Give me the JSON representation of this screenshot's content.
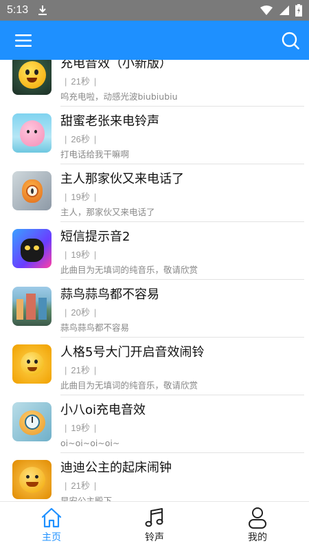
{
  "status_bar": {
    "time": "5:13"
  },
  "appbar": {
    "menu_icon": "menu-icon",
    "search_icon": "search-icon",
    "color": "#1e90ff"
  },
  "ringtones": [
    {
      "title": "充电音效（小新版）",
      "duration": "21秒",
      "description": "呜充电啦，动感光波biubiubiu",
      "thumb": "yellow-emoji"
    },
    {
      "title": "甜蜜老张来电铃声",
      "duration": "26秒",
      "description": "打电话给我干嘛啊",
      "thumb": "pink-blob"
    },
    {
      "title": "主人那家伙又来电话了",
      "duration": "19秒",
      "description": "主人，那家伙又来电话了",
      "thumb": "alarm-clock-creature"
    },
    {
      "title": "短信提示音2",
      "duration": "19秒",
      "description": "此曲目为无填词的纯音乐，敬请欣赏",
      "thumb": "black-cat"
    },
    {
      "title": "蒜鸟蒜鸟都不容易",
      "duration": "20秒",
      "description": "蒜鸟蒜鸟都不容易",
      "thumb": "city-scene"
    },
    {
      "title": "人格5号大门开启音效闹铃",
      "duration": "21秒",
      "description": "此曲目为无填词的纯音乐，敬请欣赏",
      "thumb": "golden-emoji"
    },
    {
      "title": "小八oi充电音效",
      "duration": "19秒",
      "description": "oi~oi~oi~oi~",
      "thumb": "clock-creature"
    },
    {
      "title": "迪迪公主的起床闹钟",
      "duration": "21秒",
      "description": "早安公主殿下",
      "thumb": "smiling-emoji"
    }
  ],
  "bottom_nav": [
    {
      "label": "主页",
      "icon": "home-icon",
      "active": true
    },
    {
      "label": "铃声",
      "icon": "music-note-icon",
      "active": false
    },
    {
      "label": "我的",
      "icon": "user-icon",
      "active": false
    }
  ],
  "colors": {
    "accent": "#1e90ff",
    "title_text": "#111111",
    "meta_text": "#999999"
  }
}
